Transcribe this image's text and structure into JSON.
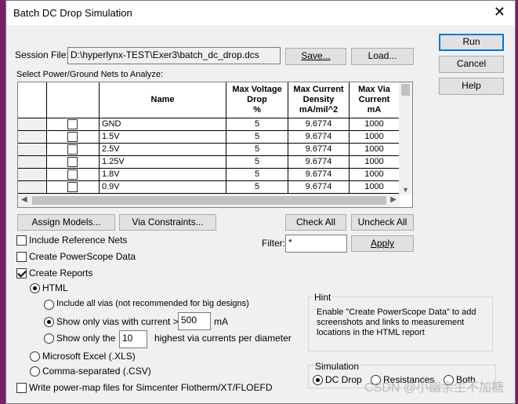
{
  "window": {
    "title": "Batch DC Drop Simulation"
  },
  "session": {
    "label": "Session File:",
    "path": "D:\\hyperlynx-TEST\\Exer3\\batch_dc_drop.dcs",
    "save_label": "Save...",
    "load_label": "Load..."
  },
  "side_buttons": {
    "run": "Run",
    "cancel": "Cancel",
    "help": "Help"
  },
  "nets": {
    "label": "Select Power/Ground Nets to Analyze:",
    "headers": [
      "Name",
      "Max Voltage Drop %",
      "Max Current Density mA/mil^2",
      "Max Via Current mA"
    ],
    "header_lines": {
      "name": [
        "Name"
      ],
      "drop": [
        "Max Voltage",
        "Drop",
        "%"
      ],
      "density": [
        "Max Current",
        "Density",
        "mA/mil^2"
      ],
      "via": [
        "Max Via",
        "Current",
        "mA"
      ]
    },
    "rows": [
      {
        "name": "GND",
        "drop": "5",
        "density": "9.6774",
        "via": "1000",
        "checked": false
      },
      {
        "name": "1.5V",
        "drop": "5",
        "density": "9.6774",
        "via": "1000",
        "checked": false
      },
      {
        "name": "2.5V",
        "drop": "5",
        "density": "9.6774",
        "via": "1000",
        "checked": false
      },
      {
        "name": "1.25V",
        "drop": "5",
        "density": "9.6774",
        "via": "1000",
        "checked": false
      },
      {
        "name": "1.8V",
        "drop": "5",
        "density": "9.6774",
        "via": "1000",
        "checked": false
      },
      {
        "name": "0.9V",
        "drop": "5",
        "density": "9.6774",
        "via": "1000",
        "checked": false
      }
    ]
  },
  "actions": {
    "assign_models": "Assign Models...",
    "via_constraints": "Via Constraints...",
    "check_all": "Check All",
    "uncheck_all": "Uncheck All",
    "filter_label": "Filter:",
    "filter_value": "*",
    "apply": "Apply"
  },
  "options": {
    "include_ref_nets": {
      "label": "Include Reference Nets",
      "checked": false
    },
    "create_powerscope": {
      "label": "Create PowerScope Data",
      "checked": false
    },
    "create_reports": {
      "label": "Create Reports",
      "checked": true
    },
    "html": {
      "label": "HTML",
      "selected": true
    },
    "include_all_vias": {
      "label": "Include all vias (not recommended for big designs)",
      "selected": false
    },
    "show_current_gt": {
      "label": "Show only vias with current >",
      "value": "500",
      "unit": "mA",
      "selected": true
    },
    "show_only_the": {
      "label": "Show only the",
      "value": "10",
      "suffix": "highest via currents per diameter",
      "selected": false
    },
    "excel": {
      "label": "Microsoft Excel (.XLS)",
      "selected": false
    },
    "csv": {
      "label": "Comma-separated (.CSV)",
      "selected": false
    },
    "power_map": {
      "label": "Write power-map files for Simcenter Flotherm/XT/FLOEFD",
      "checked": false
    }
  },
  "hint": {
    "title": "Hint",
    "text": "Enable \"Create PowerScope Data\" to add screenshots and links to measurement locations in the HTML report"
  },
  "simulation": {
    "title": "Simulation",
    "options": [
      {
        "label": "DC Drop",
        "selected": true
      },
      {
        "label": "Resistances",
        "selected": false
      },
      {
        "label": "Both",
        "selected": false
      }
    ]
  },
  "watermark": "CSDN @小幽余生不加糖",
  "colors": {
    "accent": "#0078d7",
    "background": "#f0f0f0",
    "desktop": "#8a2a6e"
  }
}
